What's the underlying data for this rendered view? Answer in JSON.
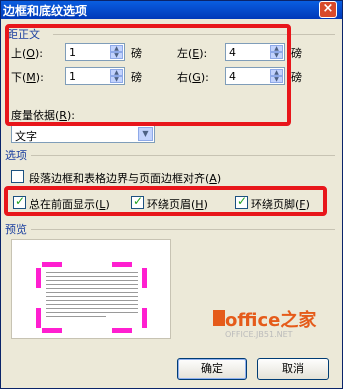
{
  "window": {
    "title": "边框和底纹选项",
    "close": "×"
  },
  "margins": {
    "group_title": "距正文",
    "top_label": "上",
    "top_key": "O",
    "top_value": "1",
    "top_unit": "磅",
    "bottom_label": "下",
    "bottom_key": "M",
    "bottom_value": "1",
    "bottom_unit": "磅",
    "left_label": "左",
    "left_key": "E",
    "left_value": "4",
    "left_unit": "磅",
    "right_label": "右",
    "right_key": "G",
    "right_value": "4",
    "right_unit": "磅",
    "measure_label": "度量依据",
    "measure_key": "R",
    "measure_value": "文字"
  },
  "options": {
    "group_title": "选项",
    "align_label": "段落边框和表格边界与页面边框对齐",
    "align_key": "A",
    "align_checked": false,
    "front_label": "总在前面显示",
    "front_key": "L",
    "front_checked": true,
    "header_label": "环绕页眉",
    "header_key": "H",
    "header_checked": true,
    "footer_label": "环绕页脚",
    "footer_key": "F",
    "footer_checked": true
  },
  "preview": {
    "group_title": "预览"
  },
  "buttons": {
    "ok": "确定",
    "cancel": "取消"
  },
  "watermark": {
    "main": "office之家",
    "sub": "OFFICE.JB51.NET"
  },
  "colors": {
    "highlight": "#e8161b",
    "margin_marker": "#ff1fd0",
    "group_title": "#1a3fa0"
  }
}
